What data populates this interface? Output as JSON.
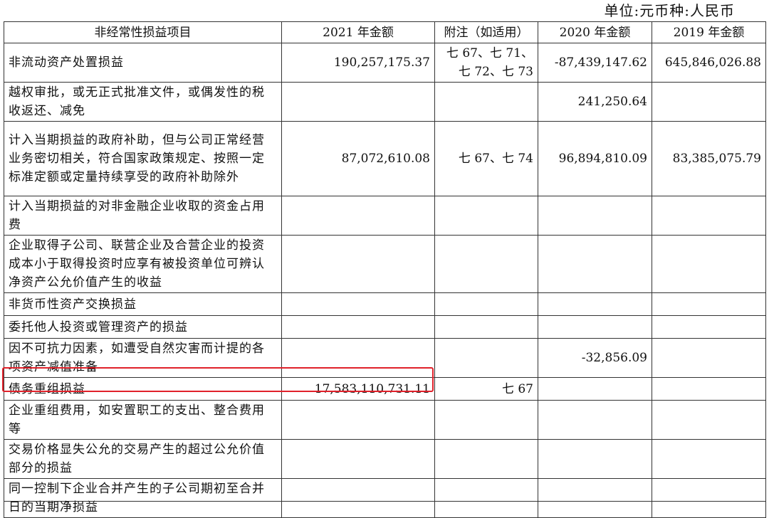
{
  "unit_label": "单位:元币种:人民币",
  "columns": [
    "非经常性损益项目",
    "2021 年金额",
    "附注（如适用）",
    "2020 年金额",
    "2019 年金额"
  ],
  "rows": [
    {
      "item": "非流动资产处置损益",
      "y2021": "190,257,175.37",
      "note": "七 67、七 71、七 72、七 73",
      "y2020": "-87,439,147.62",
      "y2019": "645,846,026.88"
    },
    {
      "item": "越权审批，或无正式批准文件，或偶发性的税收返还、减免",
      "y2021": "",
      "note": "",
      "y2020": "241,250.64",
      "y2019": ""
    },
    {
      "item": "计入当期损益的政府补助，但与公司正常经营业务密切相关，符合国家政策规定、按照一定标准定额或定量持续享受的政府补助除外",
      "y2021": "87,072,610.08",
      "note": "七 67、七 74",
      "y2020": "96,894,810.09",
      "y2019": "83,385,075.79"
    },
    {
      "item": "计入当期损益的对非金融企业收取的资金占用费",
      "y2021": "",
      "note": "",
      "y2020": "",
      "y2019": ""
    },
    {
      "item": "企业取得子公司、联营企业及合营企业的投资成本小于取得投资时应享有被投资单位可辨认净资产公允价值产生的收益",
      "y2021": "",
      "note": "",
      "y2020": "",
      "y2019": ""
    },
    {
      "item": "非货币性资产交换损益",
      "y2021": "",
      "note": "",
      "y2020": "",
      "y2019": ""
    },
    {
      "item": "委托他人投资或管理资产的损益",
      "y2021": "",
      "note": "",
      "y2020": "",
      "y2019": ""
    },
    {
      "item": "因不可抗力因素，如遭受自然灾害而计提的各项资产减值准备",
      "y2021": "",
      "note": "",
      "y2020": "-32,856.09",
      "y2019": ""
    },
    {
      "item": "债务重组损益",
      "y2021": "17,583,110,731.11",
      "note": "七 67",
      "y2020": "",
      "y2019": ""
    },
    {
      "item": "企业重组费用，如安置职工的支出、整合费用等",
      "y2021": "",
      "note": "",
      "y2020": "",
      "y2019": ""
    },
    {
      "item": "交易价格显失公允的交易产生的超过公允价值部分的损益",
      "y2021": "",
      "note": "",
      "y2020": "",
      "y2019": ""
    },
    {
      "item": "同一控制下企业合并产生的子公司期初至合并日的当期净损益",
      "y2021": "",
      "note": "",
      "y2020": "",
      "y2019": ""
    }
  ],
  "highlight_color": "#e0212a"
}
